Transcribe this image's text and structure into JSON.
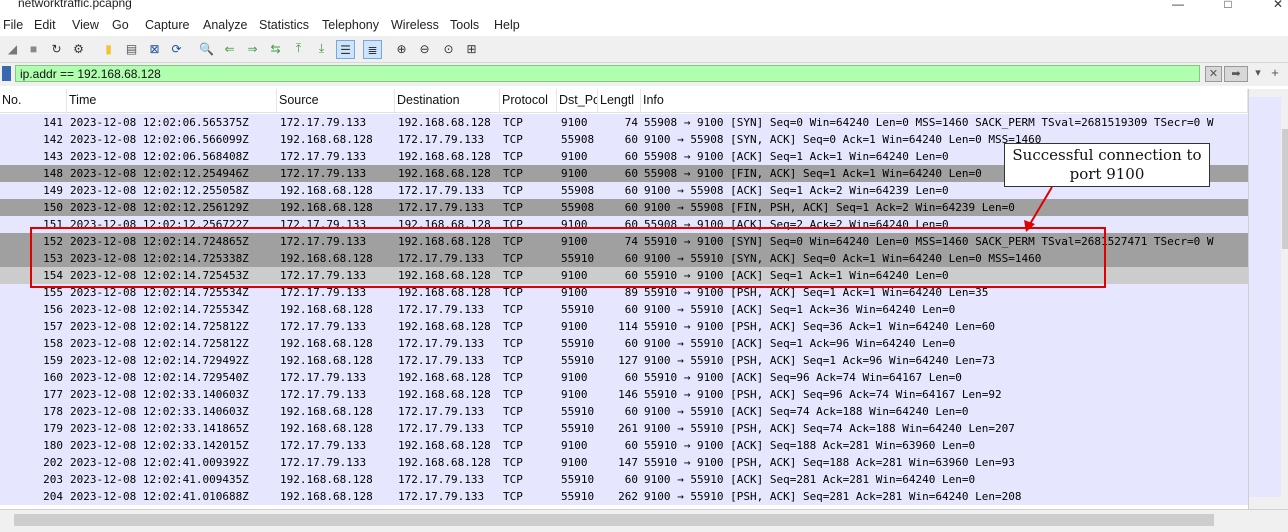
{
  "window": {
    "title": "networktraffic.pcapng"
  },
  "menu": [
    "File",
    "Edit",
    "View",
    "Go",
    "Capture",
    "Analyze",
    "Statistics",
    "Telephony",
    "Wireless",
    "Tools",
    "Help"
  ],
  "toolbar": [
    "shark-fin-start-icon",
    "stop-icon",
    "restart-icon",
    "options-icon",
    "open-icon",
    "save-icon",
    "close-file-icon",
    "reload-icon",
    "find-icon",
    "go-back-icon",
    "go-forward-icon",
    "go-to-packet-icon",
    "first-packet-icon",
    "last-packet-icon",
    "autoscroll-icon",
    "colorize-icon",
    "zoom-in-icon",
    "zoom-out-icon",
    "zoom-normal-icon",
    "resize-columns-icon"
  ],
  "filter": {
    "value": "ip.addr == 192.168.68.128"
  },
  "columns": [
    "No.",
    "Time",
    "Source",
    "Destination",
    "Protocol",
    "Dst_Po",
    "Lengtl",
    "Info"
  ],
  "rows": [
    {
      "no": "141",
      "time": "2023-12-08 12:02:06.565375Z",
      "src": "172.17.79.133",
      "dst": "192.168.68.128",
      "proto": "TCP",
      "dport": "9100",
      "len": "74",
      "info": "55908 → 9100 [SYN] Seq=0 Win=64240 Len=0 MSS=1460 SACK_PERM TSval=2681519309 TSecr=0 W",
      "style": "tcp"
    },
    {
      "no": "142",
      "time": "2023-12-08 12:02:06.566099Z",
      "src": "192.168.68.128",
      "dst": "172.17.79.133",
      "proto": "TCP",
      "dport": "55908",
      "len": "60",
      "info": "9100 → 55908 [SYN, ACK] Seq=0 Ack=1 Win=64240 Len=0 MSS=1460",
      "style": "tcp"
    },
    {
      "no": "143",
      "time": "2023-12-08 12:02:06.568408Z",
      "src": "172.17.79.133",
      "dst": "192.168.68.128",
      "proto": "TCP",
      "dport": "9100",
      "len": "60",
      "info": "55908 → 9100 [ACK] Seq=1 Ack=1 Win=64240 Len=0",
      "style": "tcp"
    },
    {
      "no": "148",
      "time": "2023-12-08 12:02:12.254946Z",
      "src": "172.17.79.133",
      "dst": "192.168.68.128",
      "proto": "TCP",
      "dport": "9100",
      "len": "60",
      "info": "55908 → 9100 [FIN, ACK] Seq=1 Ack=1 Win=64240 Len=0",
      "style": "dark"
    },
    {
      "no": "149",
      "time": "2023-12-08 12:02:12.255058Z",
      "src": "192.168.68.128",
      "dst": "172.17.79.133",
      "proto": "TCP",
      "dport": "55908",
      "len": "60",
      "info": "9100 → 55908 [ACK] Seq=1 Ack=2 Win=64239 Len=0",
      "style": "tcp"
    },
    {
      "no": "150",
      "time": "2023-12-08 12:02:12.256129Z",
      "src": "192.168.68.128",
      "dst": "172.17.79.133",
      "proto": "TCP",
      "dport": "55908",
      "len": "60",
      "info": "9100 → 55908 [FIN, PSH, ACK] Seq=1 Ack=2 Win=64239 Len=0",
      "style": "dark"
    },
    {
      "no": "151",
      "time": "2023-12-08 12:02:12.256722Z",
      "src": "172.17.79.133",
      "dst": "192.168.68.128",
      "proto": "TCP",
      "dport": "9100",
      "len": "60",
      "info": "55908 → 9100 [ACK] Seq=2 Ack=2 Win=64240 Len=0",
      "style": "tcp"
    },
    {
      "no": "152",
      "time": "2023-12-08 12:02:14.724865Z",
      "src": "172.17.79.133",
      "dst": "192.168.68.128",
      "proto": "TCP",
      "dport": "9100",
      "len": "74",
      "info": "55910 → 9100 [SYN] Seq=0 Win=64240 Len=0 MSS=1460 SACK_PERM TSval=2681527471 TSecr=0 W",
      "style": "dark"
    },
    {
      "no": "153",
      "time": "2023-12-08 12:02:14.725338Z",
      "src": "192.168.68.128",
      "dst": "172.17.79.133",
      "proto": "TCP",
      "dport": "55910",
      "len": "60",
      "info": "9100 → 55910 [SYN, ACK] Seq=0 Ack=1 Win=64240 Len=0 MSS=1460",
      "style": "dark"
    },
    {
      "no": "154",
      "time": "2023-12-08 12:02:14.725453Z",
      "src": "172.17.79.133",
      "dst": "192.168.68.128",
      "proto": "TCP",
      "dport": "9100",
      "len": "60",
      "info": "55910 → 9100 [ACK] Seq=1 Ack=1 Win=64240 Len=0",
      "style": "sel"
    },
    {
      "no": "155",
      "time": "2023-12-08 12:02:14.725534Z",
      "src": "172.17.79.133",
      "dst": "192.168.68.128",
      "proto": "TCP",
      "dport": "9100",
      "len": "89",
      "info": "55910 → 9100 [PSH, ACK] Seq=1 Ack=1 Win=64240 Len=35",
      "style": "tcp"
    },
    {
      "no": "156",
      "time": "2023-12-08 12:02:14.725534Z",
      "src": "192.168.68.128",
      "dst": "172.17.79.133",
      "proto": "TCP",
      "dport": "55910",
      "len": "60",
      "info": "9100 → 55910 [ACK] Seq=1 Ack=36 Win=64240 Len=0",
      "style": "tcp"
    },
    {
      "no": "157",
      "time": "2023-12-08 12:02:14.725812Z",
      "src": "172.17.79.133",
      "dst": "192.168.68.128",
      "proto": "TCP",
      "dport": "9100",
      "len": "114",
      "info": "55910 → 9100 [PSH, ACK] Seq=36 Ack=1 Win=64240 Len=60",
      "style": "tcp"
    },
    {
      "no": "158",
      "time": "2023-12-08 12:02:14.725812Z",
      "src": "192.168.68.128",
      "dst": "172.17.79.133",
      "proto": "TCP",
      "dport": "55910",
      "len": "60",
      "info": "9100 → 55910 [ACK] Seq=1 Ack=96 Win=64240 Len=0",
      "style": "tcp"
    },
    {
      "no": "159",
      "time": "2023-12-08 12:02:14.729492Z",
      "src": "192.168.68.128",
      "dst": "172.17.79.133",
      "proto": "TCP",
      "dport": "55910",
      "len": "127",
      "info": "9100 → 55910 [PSH, ACK] Seq=1 Ack=96 Win=64240 Len=73",
      "style": "tcp"
    },
    {
      "no": "160",
      "time": "2023-12-08 12:02:14.729540Z",
      "src": "172.17.79.133",
      "dst": "192.168.68.128",
      "proto": "TCP",
      "dport": "9100",
      "len": "60",
      "info": "55910 → 9100 [ACK] Seq=96 Ack=74 Win=64167 Len=0",
      "style": "tcp"
    },
    {
      "no": "177",
      "time": "2023-12-08 12:02:33.140603Z",
      "src": "172.17.79.133",
      "dst": "192.168.68.128",
      "proto": "TCP",
      "dport": "9100",
      "len": "146",
      "info": "55910 → 9100 [PSH, ACK] Seq=96 Ack=74 Win=64167 Len=92",
      "style": "tcp"
    },
    {
      "no": "178",
      "time": "2023-12-08 12:02:33.140603Z",
      "src": "192.168.68.128",
      "dst": "172.17.79.133",
      "proto": "TCP",
      "dport": "55910",
      "len": "60",
      "info": "9100 → 55910 [ACK] Seq=74 Ack=188 Win=64240 Len=0",
      "style": "tcp"
    },
    {
      "no": "179",
      "time": "2023-12-08 12:02:33.141865Z",
      "src": "192.168.68.128",
      "dst": "172.17.79.133",
      "proto": "TCP",
      "dport": "55910",
      "len": "261",
      "info": "9100 → 55910 [PSH, ACK] Seq=74 Ack=188 Win=64240 Len=207",
      "style": "tcp"
    },
    {
      "no": "180",
      "time": "2023-12-08 12:02:33.142015Z",
      "src": "172.17.79.133",
      "dst": "192.168.68.128",
      "proto": "TCP",
      "dport": "9100",
      "len": "60",
      "info": "55910 → 9100 [ACK] Seq=188 Ack=281 Win=63960 Len=0",
      "style": "tcp"
    },
    {
      "no": "202",
      "time": "2023-12-08 12:02:41.009392Z",
      "src": "172.17.79.133",
      "dst": "192.168.68.128",
      "proto": "TCP",
      "dport": "9100",
      "len": "147",
      "info": "55910 → 9100 [PSH, ACK] Seq=188 Ack=281 Win=63960 Len=93",
      "style": "tcp"
    },
    {
      "no": "203",
      "time": "2023-12-08 12:02:41.009435Z",
      "src": "192.168.68.128",
      "dst": "172.17.79.133",
      "proto": "TCP",
      "dport": "55910",
      "len": "60",
      "info": "9100 → 55910 [ACK] Seq=281 Ack=281 Win=64240 Len=0",
      "style": "tcp"
    },
    {
      "no": "204",
      "time": "2023-12-08 12:02:41.010688Z",
      "src": "192.168.68.128",
      "dst": "172.17.79.133",
      "proto": "TCP",
      "dport": "55910",
      "len": "262",
      "info": "9100 → 55910 [PSH, ACK] Seq=281 Ack=281 Win=64240 Len=208",
      "style": "tcp"
    }
  ],
  "annotation": {
    "text": "Successful connection to port 9100"
  },
  "colors": {
    "tcp_row": "#e7e6ff",
    "dark_row": "#a0a0a0",
    "selected_row": "#cccccc",
    "filter_ok": "#afffaf",
    "highlight": "#e00000"
  }
}
